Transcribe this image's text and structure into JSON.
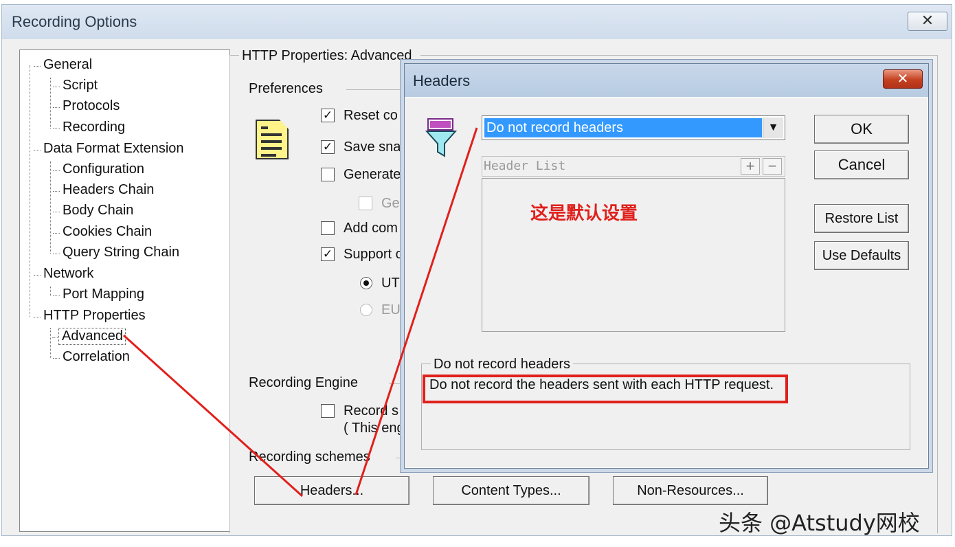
{
  "window": {
    "title": "Recording Options",
    "close_glyph": "✕"
  },
  "tree": {
    "items": [
      {
        "label": "General"
      },
      {
        "label": "Script"
      },
      {
        "label": "Protocols"
      },
      {
        "label": "Recording"
      },
      {
        "label": "Data Format Extension"
      },
      {
        "label": "Configuration"
      },
      {
        "label": "Headers Chain"
      },
      {
        "label": "Body Chain"
      },
      {
        "label": "Cookies Chain"
      },
      {
        "label": "Query String Chain"
      },
      {
        "label": "Network"
      },
      {
        "label": "Port Mapping"
      },
      {
        "label": "HTTP Properties"
      },
      {
        "label": "Advanced"
      },
      {
        "label": "Correlation"
      }
    ],
    "selected": "Advanced"
  },
  "panel": {
    "heading": "HTTP Properties: Advanced",
    "preferences_label": "Preferences",
    "preferences_icon": "checklist-document-icon",
    "options": [
      {
        "label": "Reset co",
        "checked": true
      },
      {
        "label": "Save sna",
        "checked": true
      },
      {
        "label": "Generate",
        "checked": false
      },
      {
        "label": "Ge",
        "checked": false,
        "disabled": true
      },
      {
        "label": "Add com",
        "checked": false
      },
      {
        "label": "Support c",
        "checked": true
      }
    ],
    "radios": [
      {
        "label": "UTI",
        "selected": true
      },
      {
        "label": "EU",
        "selected": false,
        "disabled": true
      }
    ],
    "recording_engine_label": "Recording Engine",
    "record_option": {
      "label": "Record s",
      "checked": false
    },
    "record_note": "( This eng",
    "recording_schemes_label": "Recording schemes",
    "buttons": {
      "headers": "Headers...",
      "content_types": "Content Types...",
      "non_resources": "Non-Resources..."
    }
  },
  "dialog": {
    "title": "Headers",
    "close_glyph": "✕",
    "filter_icon": "funnel-filter-icon",
    "combo_value": "Do not record headers",
    "combo_arrow": "▼",
    "header_list_label": "Header List",
    "add_glyph": "+",
    "remove_glyph": "−",
    "annotation": "这是默认设置",
    "buttons": {
      "ok": "OK",
      "cancel": "Cancel",
      "restore_list": "Restore List",
      "use_defaults": "Use Defaults"
    },
    "description_title": "Do not record headers",
    "description_text": "Do not record the headers sent with each HTTP request."
  },
  "watermark": "头条 @Atstudy网校",
  "colors": {
    "annotation_red": "#e0201c",
    "selection_blue": "#3399ff",
    "dialog_close_red": "#c4401f"
  }
}
